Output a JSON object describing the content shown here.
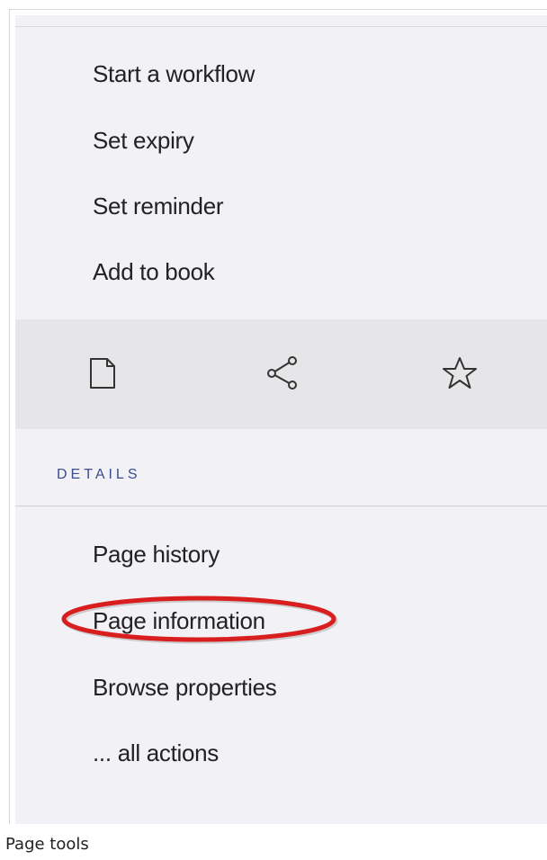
{
  "menu": {
    "items": [
      {
        "label": "Start a workflow"
      },
      {
        "label": "Set expiry"
      },
      {
        "label": "Set reminder"
      },
      {
        "label": "Add to book"
      }
    ]
  },
  "toolbar": {
    "icons": [
      "page-icon",
      "share-icon",
      "star-icon"
    ]
  },
  "details": {
    "heading": "DETAILS",
    "items": [
      {
        "label": "Page history"
      },
      {
        "label": "Page information",
        "highlighted": true
      },
      {
        "label": "Browse properties"
      },
      {
        "label": "... all actions"
      }
    ]
  },
  "caption": "Page tools",
  "colors": {
    "panel_bg": "#f1f1f6",
    "toolbar_bg": "#e6e6e8",
    "heading": "#3a4e8f",
    "highlight": "#d81e1e"
  }
}
